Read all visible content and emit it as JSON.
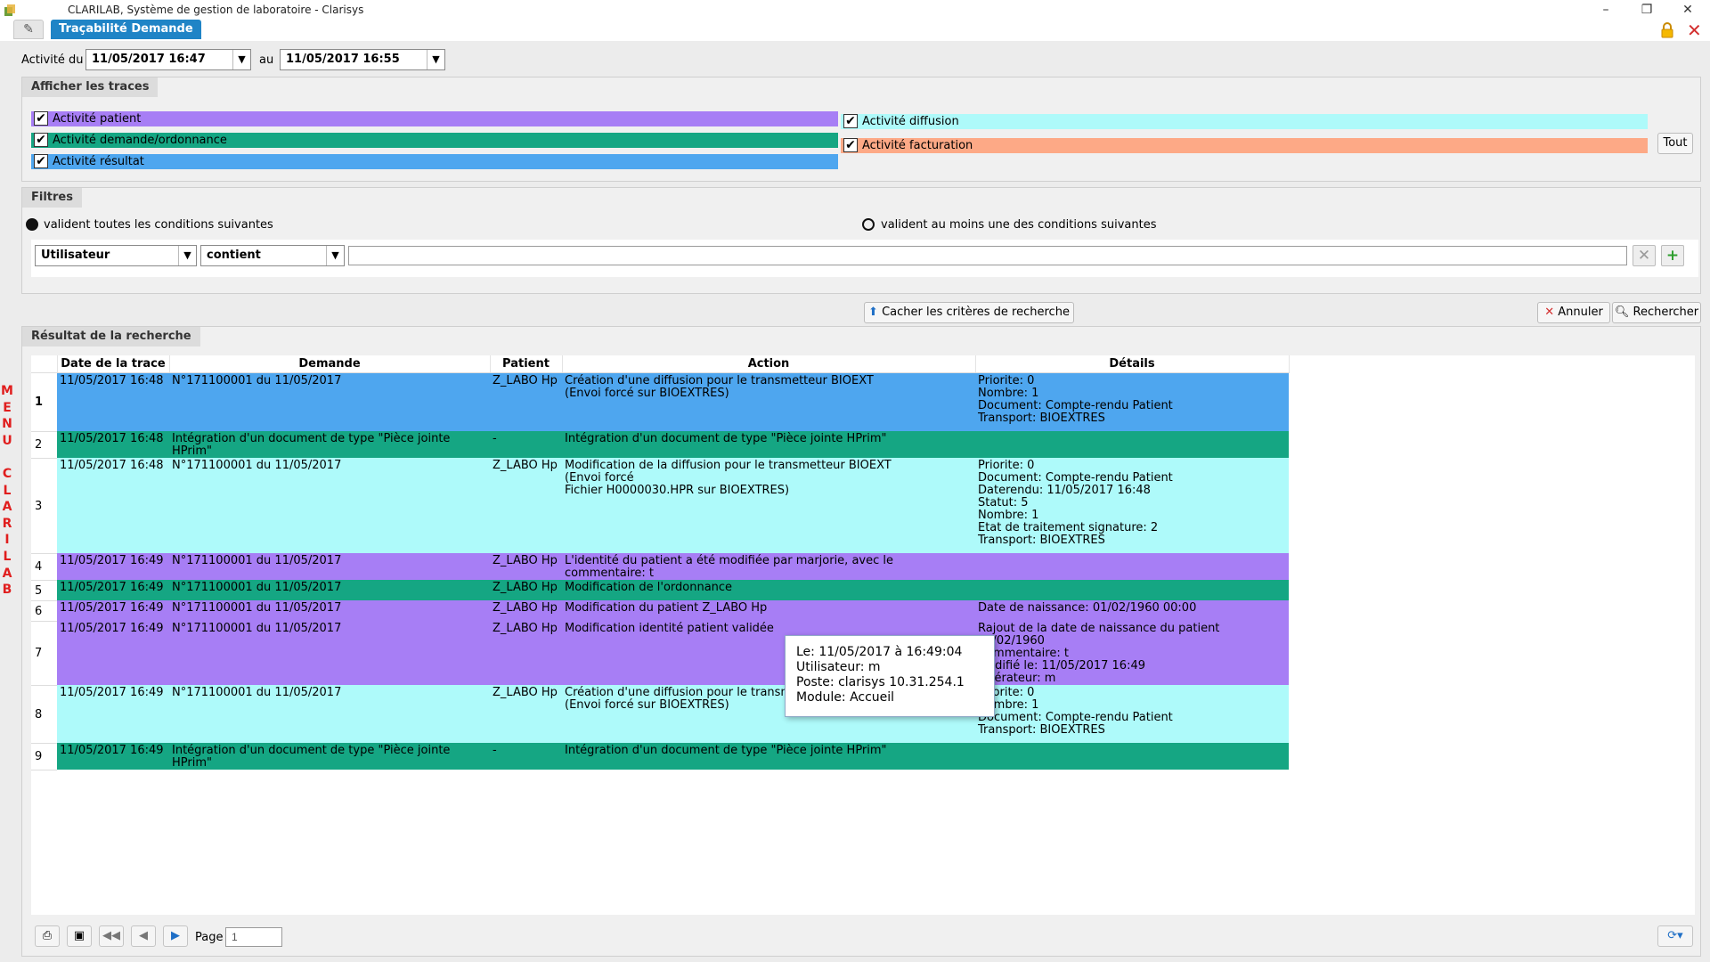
{
  "window": {
    "title": "CLARILAB, Système de gestion de laboratoire - Clarisys",
    "minimize": "–",
    "restore": "❐",
    "close": "✕"
  },
  "tab": {
    "label": "Traçabilité Demande",
    "pin": "✎"
  },
  "date_range": {
    "from_label": "Activité du",
    "from_value": "11/05/2017 16:47",
    "to_label": "au",
    "to_value": "11/05/2017 16:55"
  },
  "traces": {
    "header": "Afficher les traces",
    "items": [
      {
        "label": "Activité patient",
        "checked": true,
        "color": "#a77ef5"
      },
      {
        "label": "Activité demande/ordonnance",
        "checked": true,
        "color": "#15a683"
      },
      {
        "label": "Activité résultat",
        "checked": true,
        "color": "#4ea6ef"
      },
      {
        "label": "Activité diffusion",
        "checked": true,
        "color": "#aefafa"
      },
      {
        "label": "Activité facturation",
        "checked": true,
        "color": "#fda986"
      }
    ],
    "all_button": "Tout"
  },
  "filters": {
    "header": "Filtres",
    "option_all": "valident toutes les conditions suivantes",
    "option_any": "valident au moins une des conditions suivantes",
    "selected": "all",
    "field": "Utilisateur",
    "operator": "contient",
    "value": ""
  },
  "actions": {
    "hide_criteria": "Cacher les critères de recherche",
    "cancel": "Annuler",
    "search": "Rechercher"
  },
  "results": {
    "header": "Résultat de la recherche",
    "columns": [
      "Date de la trace",
      "Demande",
      "Patient",
      "Action",
      "Détails"
    ],
    "rows": [
      {
        "num": "1",
        "date": "11/05/2017 16:48",
        "demande": "N°171100001 du 11/05/2017",
        "patient": "Z_LABO Hp",
        "action": "Création d'une diffusion pour le transmetteur BIOEXT\n(Envoi forcé sur BIOEXTRES)",
        "details": "Priorite: 0\nNombre: 1\nDocument: Compte-rendu Patient\nTransport: BIOEXTRES",
        "color": "#4ea6ef"
      },
      {
        "num": "2",
        "date": "11/05/2017 16:48",
        "demande": "Intégration d'un document de type \"Pièce jointe HPrim\"",
        "patient": "-",
        "action": "Intégration d'un document de type \"Pièce jointe HPrim\"",
        "details": "",
        "color": "#15a683"
      },
      {
        "num": "3",
        "date": "11/05/2017 16:48",
        "demande": "N°171100001 du 11/05/2017",
        "patient": "Z_LABO Hp",
        "action": "Modification de la diffusion pour le transmetteur BIOEXT\n(Envoi forcé\nFichier H0000030.HPR sur BIOEXTRES)",
        "details": "Priorite: 0\nDocument: Compte-rendu Patient\nDaterendu: 11/05/2017 16:48\nStatut: 5\nNombre: 1\nEtat de traitement signature: 2\nTransport: BIOEXTRES",
        "color": "#aefafa"
      },
      {
        "num": "4",
        "date": "11/05/2017 16:49",
        "demande": "N°171100001 du 11/05/2017",
        "patient": "Z_LABO Hp",
        "action": "L'identité du patient a été modifiée par marjorie, avec le commentaire: t",
        "details": "",
        "color": "#a77ef5"
      },
      {
        "num": "5",
        "date": "11/05/2017 16:49",
        "demande": "N°171100001 du 11/05/2017",
        "patient": "Z_LABO Hp",
        "action": "Modification de l'ordonnance",
        "details": "",
        "color": "#15a683"
      },
      {
        "num": "6",
        "date": "11/05/2017 16:49",
        "demande": "N°171100001 du 11/05/2017",
        "patient": "Z_LABO Hp",
        "action": "Modification du patient Z_LABO Hp",
        "details": "Date de naissance: 01/02/1960 00:00",
        "color": "#a77ef5"
      },
      {
        "num": "7",
        "date": "11/05/2017 16:49",
        "demande": "N°171100001 du 11/05/2017",
        "patient": "Z_LABO Hp",
        "action": "Modification identité patient validée",
        "details": "Rajout de la date de naissance du patient 01/02/1960\nCommentaire: t\nModifié le: 11/05/2017 16:49\nOpérateur: m",
        "color": "#a77ef5"
      },
      {
        "num": "8",
        "date": "11/05/2017 16:49",
        "demande": "N°171100001 du 11/05/2017",
        "patient": "Z_LABO Hp",
        "action": "Création d'une diffusion pour le transmetteur BIOEXT\n(Envoi forcé sur BIOEXTRES)",
        "details": "Priorite: 0\nNombre: 1\nDocument: Compte-rendu Patient\nTransport: BIOEXTRES",
        "color": "#aefafa"
      },
      {
        "num": "9",
        "date": "11/05/2017 16:49",
        "demande": "Intégration d'un document de type \"Pièce jointe HPrim\"",
        "patient": "-",
        "action": "Intégration d'un document de type \"Pièce jointe HPrim\"",
        "details": "",
        "color": "#15a683"
      }
    ],
    "tooltip": [
      "Le: 11/05/2017 à 16:49:04",
      "Utilisateur: m",
      "Poste: clarisys 10.31.254.1",
      "Module: Accueil"
    ]
  },
  "pager": {
    "page_label": "Page",
    "page_value": "1"
  },
  "side_menu": [
    "M",
    "E",
    "N",
    "U",
    "",
    "C",
    "L",
    "A",
    "R",
    "I",
    "L",
    "A",
    "B"
  ]
}
